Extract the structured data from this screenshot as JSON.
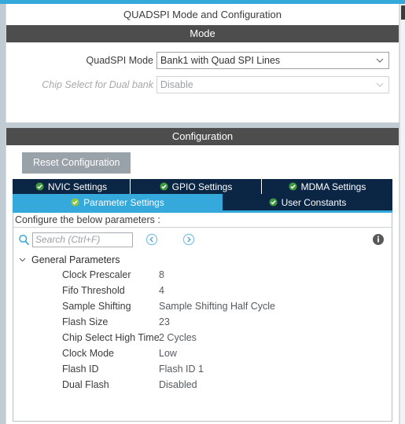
{
  "window": {
    "title": "QUADSPI Mode and Configuration"
  },
  "mode_section": {
    "header": "Mode",
    "fields": [
      {
        "label": "QuadSPI Mode",
        "value": "Bank1 with Quad SPI Lines",
        "disabled": false
      },
      {
        "label": "Chip Select for Dual bank",
        "value": "Disable",
        "disabled": true
      }
    ]
  },
  "config_section": {
    "header": "Configuration",
    "reset_button": "Reset Configuration",
    "tabs_row1": [
      {
        "label": "NVIC Settings",
        "active": false
      },
      {
        "label": "GPIO Settings",
        "active": false
      },
      {
        "label": "MDMA Settings",
        "active": false
      }
    ],
    "tabs_row2": [
      {
        "label": "Parameter Settings",
        "active": true
      },
      {
        "label": "User Constants",
        "active": false
      }
    ],
    "configure_note": "Configure the below parameters :",
    "search": {
      "placeholder": "Search (Ctrl+F)",
      "value": ""
    },
    "tree_group": "General Parameters",
    "parameters": [
      {
        "name": "Clock Prescaler",
        "value": "8"
      },
      {
        "name": "Fifo Threshold",
        "value": "4"
      },
      {
        "name": "Sample Shifting",
        "value": "Sample Shifting Half Cycle"
      },
      {
        "name": "Flash Size",
        "value": "23"
      },
      {
        "name": "Chip Select High Time",
        "value": "2 Cycles"
      },
      {
        "name": "Clock Mode",
        "value": "Low"
      },
      {
        "name": "Flash ID",
        "value": "Flash ID 1"
      },
      {
        "name": "Dual Flash",
        "value": "Disabled"
      }
    ]
  },
  "icons": {
    "search": "search-icon",
    "prev": "previous-match-icon",
    "next": "next-match-icon",
    "info": "info-icon",
    "check": "check-ok-icon",
    "expand": "chevron-down-icon",
    "combo": "chevron-down-icon"
  },
  "colors": {
    "accent": "#35a8dc",
    "section_header": "#4d4d4d",
    "tab_inactive": "#0b2545",
    "tab_active": "#35a8dc",
    "check_green": "#3f9a3f",
    "panel_gap": "#c0ccd2"
  }
}
